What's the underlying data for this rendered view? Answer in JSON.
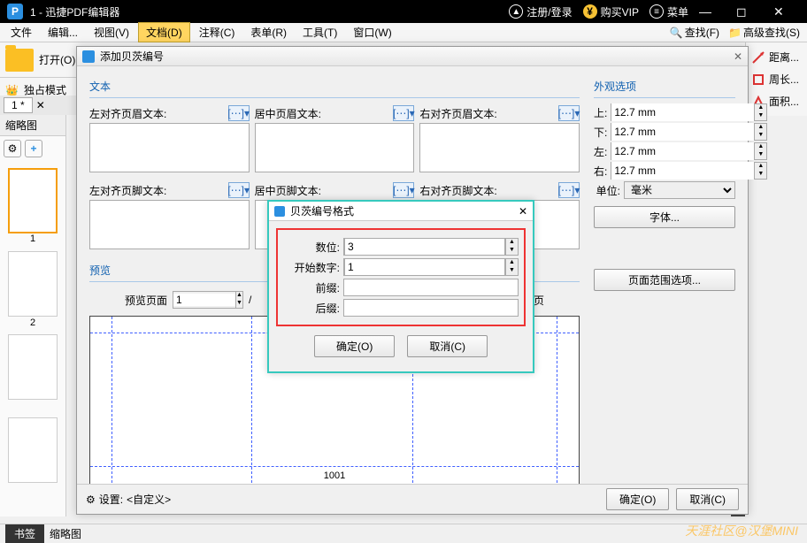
{
  "titlebar": {
    "app_title": "1 - 迅捷PDF编辑器",
    "register_login": "注册/登录",
    "buy_vip": "购买VIP",
    "menu": "菜单"
  },
  "menubar": {
    "file": "文件",
    "edit": "编辑...",
    "view": "视图(V)",
    "document": "文档(D)",
    "comment": "注释(C)",
    "form": "表单(R)",
    "tools": "工具(T)",
    "window": "窗口(W)",
    "find": "查找(F)",
    "adv_find": "高级查找(S)"
  },
  "toolbar": {
    "open": "打开(O)...",
    "exclusive_mode": "独占模式"
  },
  "side_tools": {
    "distance": "距离...",
    "perimeter": "周长...",
    "area": "面积..."
  },
  "doc_tab": "1 *",
  "left_panel": {
    "header": "缩略图",
    "bookmark_tab": "书签",
    "thumb_tab": "缩略图"
  },
  "bates_dialog": {
    "title": "添加贝茨编号",
    "text_group": "文本",
    "hf": {
      "header_left": "左对齐页眉文本:",
      "header_center": "居中页眉文本:",
      "header_right": "右对齐页眉文本:",
      "footer_left": "左对齐页脚文本:",
      "footer_center": "居中页脚文本:",
      "footer_right": "右对齐页脚文本:"
    },
    "appearance_group": "外观选项",
    "margins": {
      "top_label": "上:",
      "top": "12.7 mm",
      "bottom_label": "下:",
      "bottom": "12.7 mm",
      "left_label": "左:",
      "left": "12.7 mm",
      "right_label": "右:",
      "right": "12.7 mm",
      "unit_label": "单位:",
      "unit": "毫米"
    },
    "font_btn": "字体...",
    "page_range_btn": "页面范围选项...",
    "preview_group": "预览",
    "preview_page_label": "预览页面",
    "preview_page_val": "1",
    "total_pages": "20 页",
    "preview_number": "1001",
    "settings_label": "设置:",
    "settings_value": "<自定义>",
    "ok": "确定(O)",
    "cancel": "取消(C)"
  },
  "format_dialog": {
    "title": "贝茨编号格式",
    "digits_label": "数位:",
    "digits_val": "3",
    "start_label": "开始数字:",
    "start_val": "1",
    "prefix_label": "前缀:",
    "prefix_val": "",
    "suffix_label": "后缀:",
    "suffix_val": "",
    "ok": "确定(O)",
    "cancel": "取消(C)"
  },
  "watermark": "天涯社区@汉堡MINI"
}
